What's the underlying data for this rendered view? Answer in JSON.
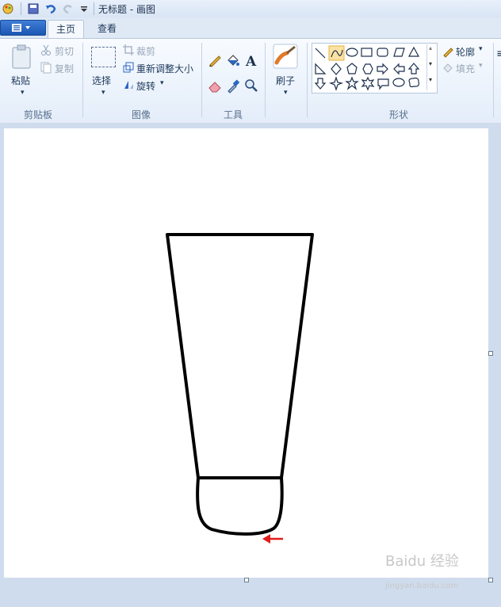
{
  "window": {
    "title": "无标题 - 画图"
  },
  "tabs": [
    {
      "label": "主页"
    },
    {
      "label": "查看"
    }
  ],
  "ribbon": {
    "clipboard": {
      "paste": "粘贴",
      "cut": "剪切",
      "copy": "复制",
      "group": "剪贴板"
    },
    "image": {
      "select": "选择",
      "crop": "裁剪",
      "resize": "重新调整大小",
      "rotate": "旋转",
      "group": "图像"
    },
    "tools": {
      "group": "工具"
    },
    "brushes": {
      "label": "刷子"
    },
    "shapes": {
      "outline": "轮廓",
      "fill": "填充",
      "group": "形状"
    }
  },
  "watermark": {
    "text": "Baidu 经验",
    "sub": "jingyan.baidu.com"
  },
  "colors": {
    "accent": "#1b56b3",
    "arrow": "#e31b1b"
  }
}
